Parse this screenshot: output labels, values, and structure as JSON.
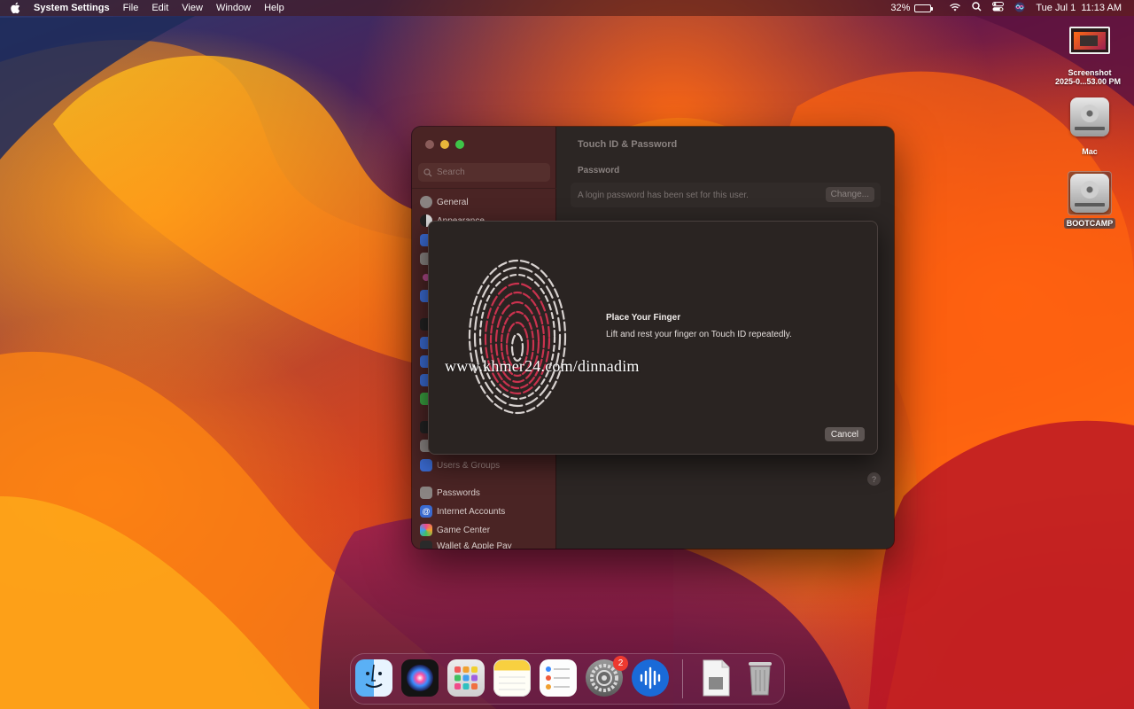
{
  "menubar": {
    "app_name": "System Settings",
    "menus": [
      "File",
      "Edit",
      "View",
      "Window",
      "Help"
    ],
    "battery_percent": "32%",
    "battery_level": 0.32,
    "datetime": "Tue Jul 1  11:13 AM"
  },
  "desktop": {
    "screenshot_label_1": "Screenshot",
    "screenshot_label_2": "2025-0...53.00 PM",
    "mac_label": "Mac",
    "bootcamp_label": "BOOTCAMP"
  },
  "window": {
    "search_placeholder": "Search",
    "sidebar": {
      "general": "General",
      "appearance": "Appearance",
      "users_groups": "Users & Groups",
      "passwords": "Passwords",
      "internet_accounts": "Internet Accounts",
      "game_center": "Game Center",
      "wallet": "Wallet & Apple Pay"
    },
    "title": "Touch ID & Password",
    "password_section": "Password",
    "password_text": "A login password has been set for this user.",
    "change_button": "Change...",
    "help_button": "?"
  },
  "sheet": {
    "title": "Place Your Finger",
    "text": "Lift and rest your finger on Touch ID repeatedly.",
    "cancel_button": "Cancel"
  },
  "watermark": "www.khmer24.com/dinnadim",
  "dock": {
    "system_settings_badge": "2"
  },
  "colors": {
    "accent_red": "#ee3a30",
    "fingerprint_red": "#c9324e"
  }
}
